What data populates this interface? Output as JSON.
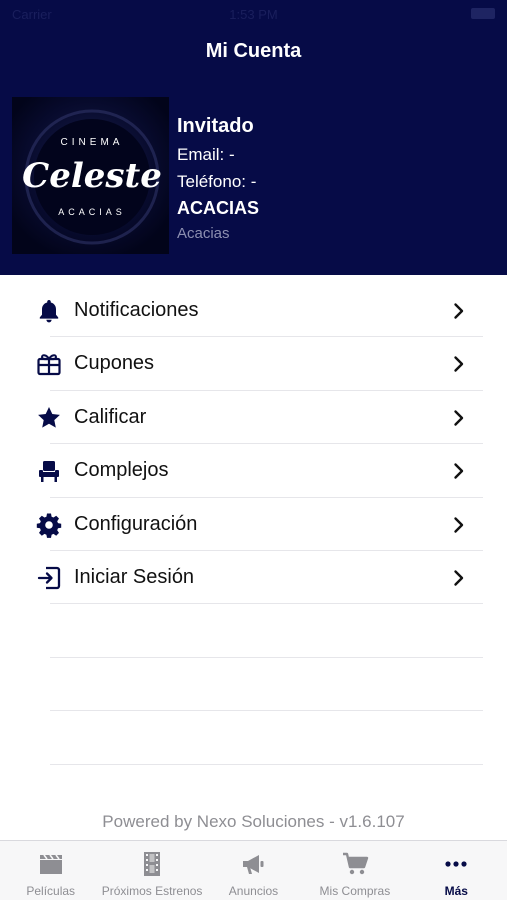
{
  "status_bar": {
    "carrier": "Carrier",
    "time": "1:53 PM"
  },
  "nav": {
    "title": "Mi Cuenta"
  },
  "logo": {
    "top_text": "CINEMA",
    "brand": "Celeste",
    "bottom_text": "ACACIAS"
  },
  "profile": {
    "name": "Invitado",
    "email": "Email: -",
    "phone": "Teléfono: -",
    "complex": "ACACIAS",
    "city": "Acacias"
  },
  "menu": [
    {
      "label": "Notificaciones",
      "icon": "bell-icon"
    },
    {
      "label": "Cupones",
      "icon": "gift-icon"
    },
    {
      "label": "Calificar",
      "icon": "star-icon"
    },
    {
      "label": "Complejos",
      "icon": "seat-icon"
    },
    {
      "label": "Configuración",
      "icon": "gear-icon"
    },
    {
      "label": "Iniciar Sesión",
      "icon": "login-icon"
    }
  ],
  "footer": {
    "powered": "Powered by Nexo Soluciones - v1.6.107"
  },
  "tabs": [
    {
      "label": "Películas",
      "icon": "clapperboard-icon",
      "active": false
    },
    {
      "label": "Próximos Estrenos",
      "icon": "film-strip-icon",
      "active": false
    },
    {
      "label": "Anuncios",
      "icon": "megaphone-icon",
      "active": false
    },
    {
      "label": "Mis Compras",
      "icon": "cart-icon",
      "active": false
    },
    {
      "label": "Más",
      "icon": "more-dots-icon",
      "active": true
    }
  ],
  "colors": {
    "header_bg": "#060b47",
    "accent": "#060b47",
    "inactive": "#8e8e93"
  }
}
